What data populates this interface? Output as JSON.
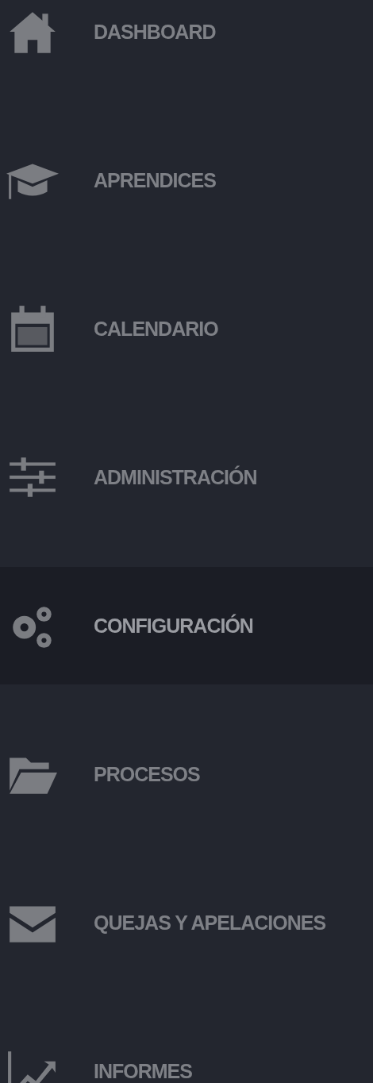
{
  "sidebar": {
    "items": [
      {
        "label": "DASHBOARD",
        "selected": false
      },
      {
        "label": "APRENDICES",
        "selected": false
      },
      {
        "label": "CALENDARIO",
        "selected": false
      },
      {
        "label": "ADMINISTRACIÓN",
        "selected": false
      },
      {
        "label": "CONFIGURACIÓN",
        "selected": true
      },
      {
        "label": "PROCESOS",
        "selected": false
      },
      {
        "label": "QUEJAS Y APELACIONES",
        "selected": false
      },
      {
        "label": "INFORMES",
        "selected": false
      }
    ]
  }
}
